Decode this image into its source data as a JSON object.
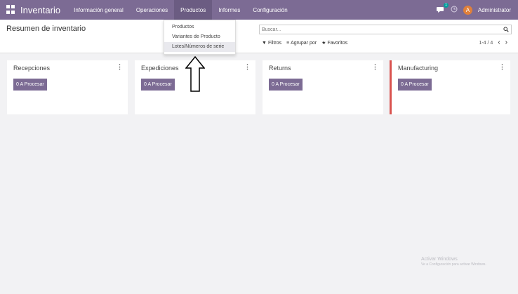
{
  "topbar": {
    "brand": "Inventario",
    "nav": [
      "Información general",
      "Operaciones",
      "Productos",
      "Informes",
      "Configuración"
    ],
    "chat_badge": "1",
    "avatar_letter": "A",
    "user": "Administrator",
    "color": "#7c6b94"
  },
  "control": {
    "title": "Resumen de inventario",
    "search_placeholder": "Buscar...",
    "filters_label": "Filtros",
    "groupby_label": "Agrupar por",
    "favorites_label": "Favoritos",
    "pager": "1-4 / 4",
    "prev": "‹",
    "next": "›"
  },
  "dropdown": {
    "items": [
      "Productos",
      "Variantes de Producto",
      "Lotes/Números de serie"
    ]
  },
  "cards": [
    {
      "title": "Recepciones",
      "button": "0 A Procesar"
    },
    {
      "title": "Expediciones",
      "button": "0 A Procesar"
    },
    {
      "title": "Returns",
      "button": "0 A Procesar"
    },
    {
      "title": "Manufacturing",
      "button": "0 A Procesar"
    }
  ],
  "watermark": {
    "title": "Activar Windows",
    "subtitle": "Ve a Configuración para activar Windows."
  }
}
